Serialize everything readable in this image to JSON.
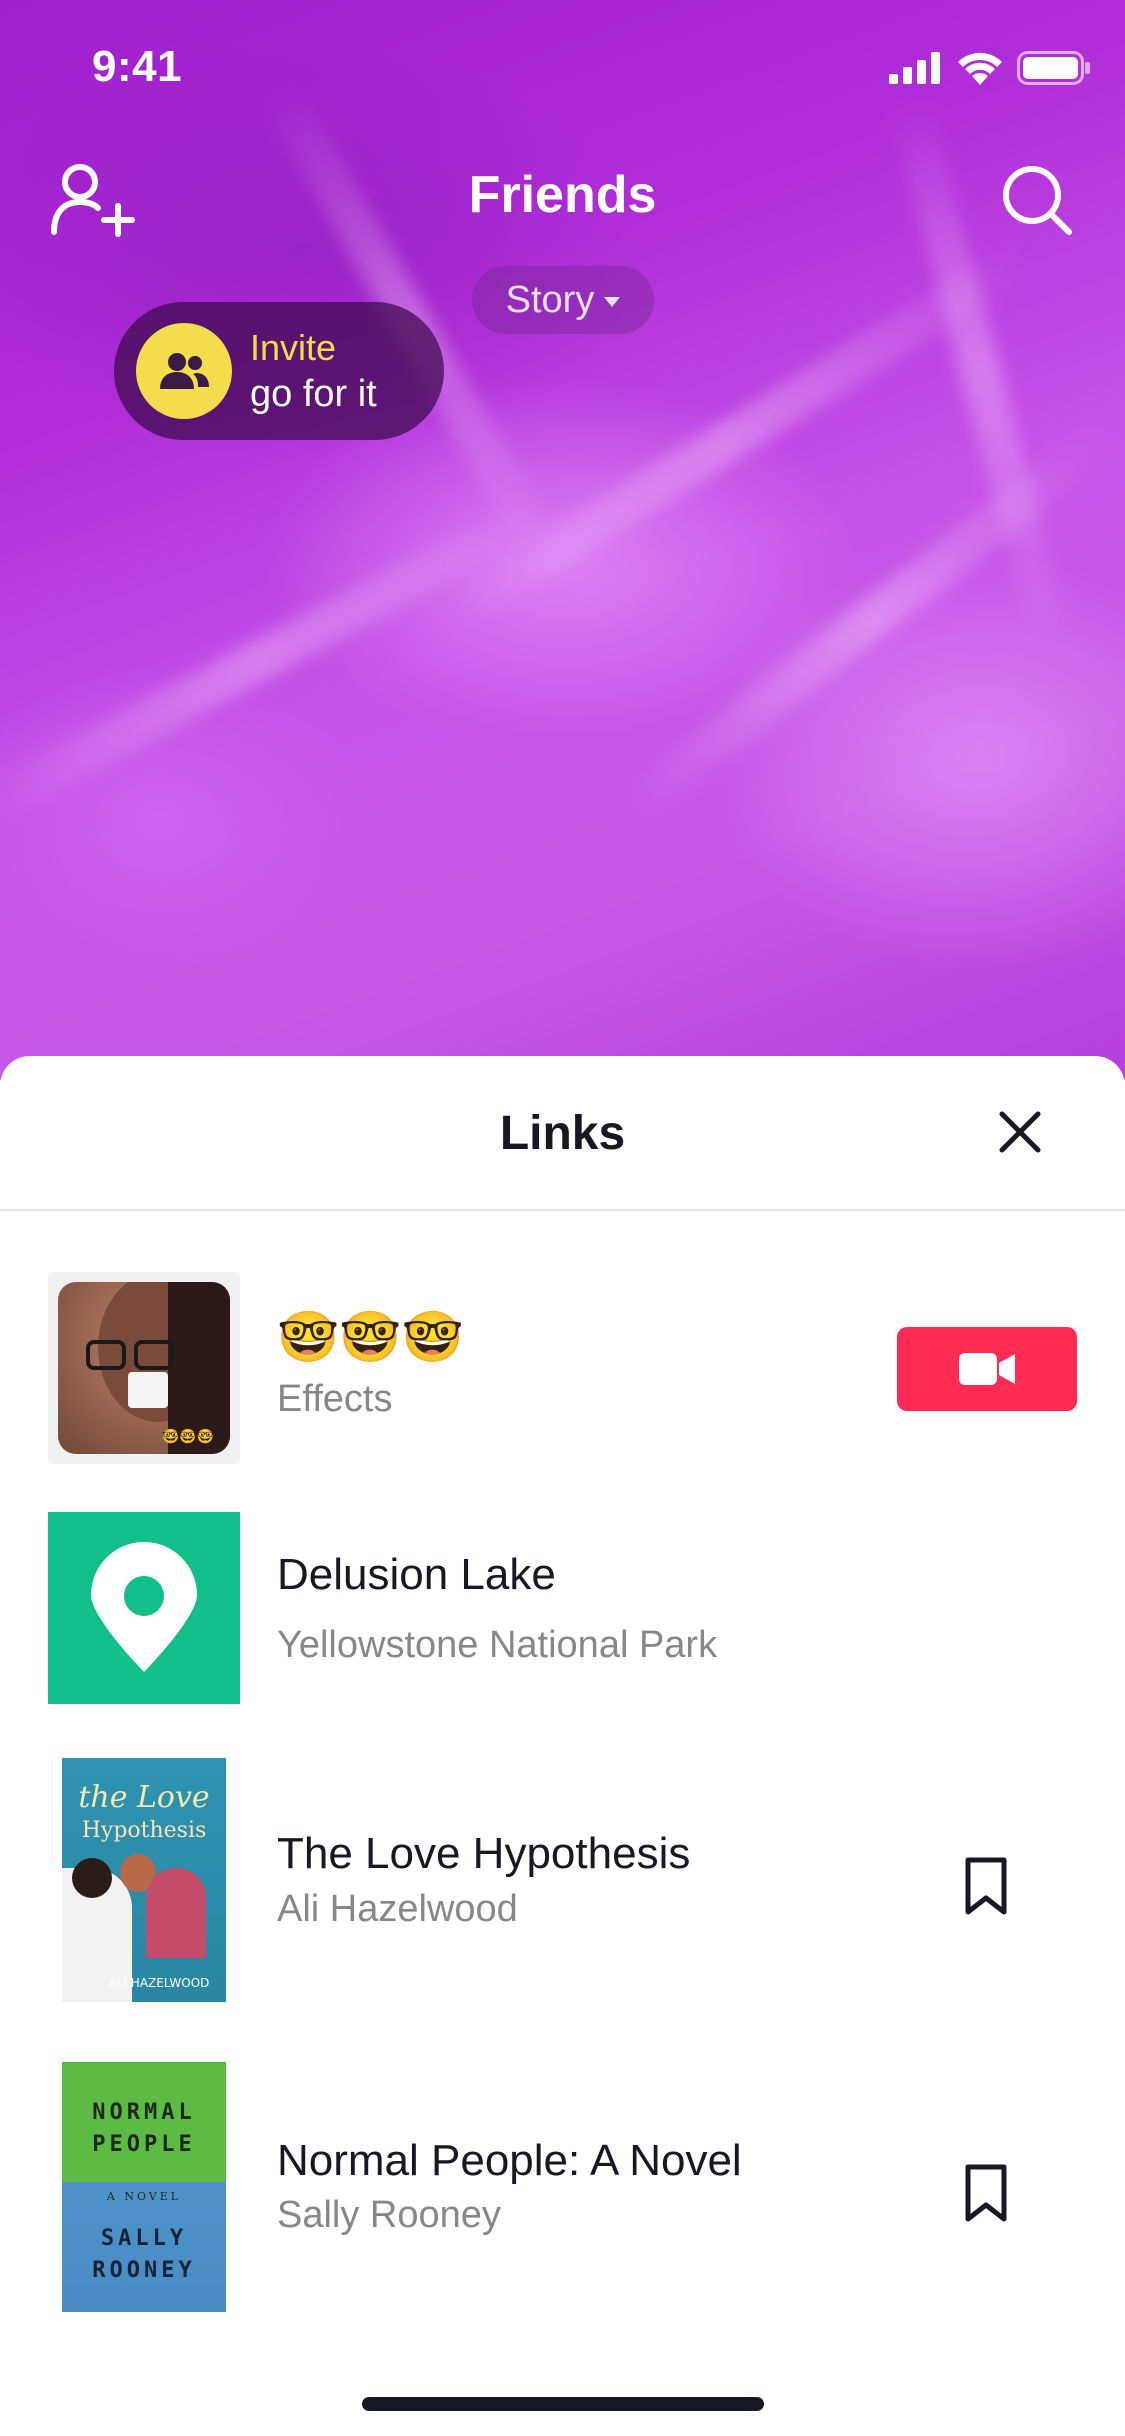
{
  "status_bar": {
    "time": "9:41"
  },
  "header": {
    "title": "Friends",
    "story_label": "Story",
    "invite": {
      "title": "Invite",
      "subtitle": "go for it"
    }
  },
  "sheet": {
    "title": "Links",
    "items": [
      {
        "kind": "effect",
        "title": "🤓🤓🤓",
        "subtitle": "Effects",
        "action": "record"
      },
      {
        "kind": "location",
        "title": "Delusion Lake",
        "subtitle": "Yellowstone National Park"
      },
      {
        "kind": "book",
        "title": "The Love Hypothesis",
        "subtitle": "Ali Hazelwood",
        "action": "bookmark",
        "cover": {
          "line1": "the Love",
          "line2": "Hypothesis",
          "author": "ALI HAZELWOOD"
        }
      },
      {
        "kind": "book",
        "title": "Normal People: A Novel",
        "subtitle": "Sally Rooney",
        "action": "bookmark",
        "cover": {
          "line1": "NORMAL",
          "line2": "PEOPLE",
          "label": "A NOVEL",
          "author1": "SALLY",
          "author2": "ROONEY"
        }
      }
    ]
  },
  "colors": {
    "accent": "#fe2c55",
    "invite_yellow": "#f3dd4c",
    "location_green": "#12be8a",
    "text_primary": "#161823",
    "text_secondary": "#86878b"
  },
  "icons": [
    "add-friend-icon",
    "search-icon",
    "caret-down-icon",
    "friends-icon",
    "close-icon",
    "video-camera-icon",
    "location-pin-icon",
    "bookmark-icon",
    "signal-icon",
    "wifi-icon",
    "battery-icon"
  ]
}
